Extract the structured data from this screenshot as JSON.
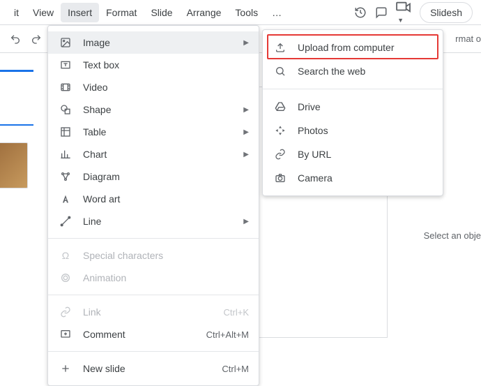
{
  "menubar": {
    "items": [
      "it",
      "View",
      "Insert",
      "Format",
      "Slide",
      "Arrange",
      "Tools",
      "…"
    ],
    "button_label": "Slidesh"
  },
  "toolbar": {
    "right_text": "rmat o"
  },
  "insert": {
    "items": [
      {
        "label": "Image",
        "arrow": true,
        "highlight": true
      },
      {
        "label": "Text box"
      },
      {
        "label": "Video"
      },
      {
        "label": "Shape",
        "arrow": true
      },
      {
        "label": "Table",
        "arrow": true
      },
      {
        "label": "Chart",
        "arrow": true
      },
      {
        "label": "Diagram"
      },
      {
        "label": "Word art"
      },
      {
        "label": "Line",
        "arrow": true
      }
    ],
    "group2": [
      {
        "label": "Special characters",
        "disabled": true
      },
      {
        "label": "Animation",
        "disabled": true
      }
    ],
    "group3": [
      {
        "label": "Link",
        "shortcut": "Ctrl+K",
        "disabled": true
      },
      {
        "label": "Comment",
        "shortcut": "Ctrl+Alt+M"
      }
    ],
    "group4": [
      {
        "label": "New slide",
        "shortcut": "Ctrl+M"
      }
    ]
  },
  "image_sub": {
    "g1": [
      {
        "label": "Upload from computer"
      },
      {
        "label": "Search the web"
      }
    ],
    "g2": [
      {
        "label": "Drive"
      },
      {
        "label": "Photos"
      },
      {
        "label": "By URL"
      },
      {
        "label": "Camera"
      }
    ]
  },
  "canvas": {
    "hint": "Select an obje"
  }
}
